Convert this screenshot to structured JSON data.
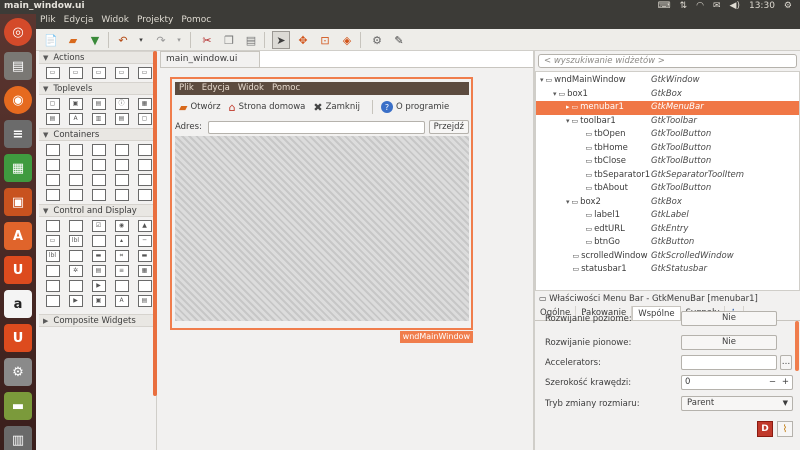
{
  "window_title": "main_window.ui",
  "tray_time": "13:30",
  "app_menu": [
    "Plik",
    "Edycja",
    "Widok",
    "Projekty",
    "Pomoc"
  ],
  "palette": {
    "groups": [
      {
        "name": "Actions",
        "icons": [
          "action-icon",
          "action-icon",
          "action-icon",
          "action-icon",
          "action-icon"
        ]
      },
      {
        "name": "Toplevels",
        "icons": [
          "window-icon",
          "dialog-icon",
          "message-icon",
          "about-icon",
          "color-icon",
          "file-icon",
          "font-icon",
          "assistant-icon",
          "recent-icon",
          "app-icon"
        ]
      },
      {
        "name": "Containers",
        "icons": [
          "box-icon",
          "grid-icon",
          "table-icon",
          "layout-icon",
          "paned-icon",
          "notebook-icon",
          "expander-icon",
          "frame-icon",
          "alignment-icon",
          "viewport-icon",
          "eventbox-icon",
          "scrolled-icon",
          "toolbar-icon",
          "menu-icon",
          "menubar-icon",
          "fixed-icon",
          "overlay-icon",
          "infobar-icon",
          "stack-icon",
          "headerbar-icon"
        ]
      },
      {
        "name": "Control and Display",
        "icons": [
          "button-icon",
          "toggle-icon",
          "check-icon",
          "radio-icon",
          "image-icon",
          "entry-icon",
          "label-icon",
          "combo-icon",
          "spin-icon",
          "scale-icon",
          "label-icon",
          "accel-icon",
          "switch-icon",
          "link-icon",
          "progress-icon",
          "level-icon",
          "spinner-icon",
          "tree-icon",
          "text-icon",
          "calendar-icon",
          "statusbar-icon",
          "separator-icon",
          "arrow-icon",
          "icon-view-icon",
          "draw-icon",
          "scroll-icon",
          "play-icon",
          "color-btn-icon",
          "font-btn-icon",
          "file-btn-icon"
        ]
      },
      {
        "name": "Composite Widgets",
        "icons": []
      }
    ]
  },
  "doc_tab": "main_window.ui",
  "preview": {
    "menu": [
      "Plik",
      "Edycja",
      "Widok",
      "Pomoc"
    ],
    "toolbar": [
      {
        "label": "Otwórz",
        "icon": "folder-open-icon"
      },
      {
        "label": "Strona domowa",
        "icon": "home-icon"
      },
      {
        "label": "Zamknij",
        "icon": "close-icon"
      },
      {
        "label": "O programie",
        "icon": "help-icon"
      }
    ],
    "address_label": "Adres:",
    "go_button": "Przejdź",
    "window_name": "wndMainWindow"
  },
  "search_placeholder": "< wyszukiwanie widżetów >",
  "tree": [
    {
      "name": "wndMainWindow",
      "type": "GtkWindow",
      "level": 0,
      "expander": "▾"
    },
    {
      "name": "box1",
      "type": "GtkBox",
      "level": 1,
      "expander": "▾"
    },
    {
      "name": "menubar1",
      "type": "GtkMenuBar",
      "level": 2,
      "expander": "▸",
      "selected": true
    },
    {
      "name": "toolbar1",
      "type": "GtkToolbar",
      "level": 2,
      "expander": "▾"
    },
    {
      "name": "tbOpen",
      "type": "GtkToolButton",
      "level": 3,
      "expander": ""
    },
    {
      "name": "tbHome",
      "type": "GtkToolButton",
      "level": 3,
      "expander": ""
    },
    {
      "name": "tbClose",
      "type": "GtkToolButton",
      "level": 3,
      "expander": ""
    },
    {
      "name": "tbSeparator1",
      "type": "GtkSeparatorToolItem",
      "level": 3,
      "expander": ""
    },
    {
      "name": "tbAbout",
      "type": "GtkToolButton",
      "level": 3,
      "expander": ""
    },
    {
      "name": "box2",
      "type": "GtkBox",
      "level": 2,
      "expander": "▾"
    },
    {
      "name": "label1",
      "type": "GtkLabel",
      "level": 3,
      "expander": ""
    },
    {
      "name": "edtURL",
      "type": "GtkEntry",
      "level": 3,
      "expander": ""
    },
    {
      "name": "btnGo",
      "type": "GtkButton",
      "level": 3,
      "expander": ""
    },
    {
      "name": "scrolledWindow",
      "type": "GtkScrolledWindow",
      "level": 2,
      "expander": ""
    },
    {
      "name": "statusbar1",
      "type": "GtkStatusbar",
      "level": 2,
      "expander": ""
    }
  ],
  "properties_header": "Właściwości Menu Bar - GtkMenuBar [menubar1]",
  "property_tabs": [
    "Ogólne",
    "Pakowanie",
    "Wspólne",
    "Sygnały"
  ],
  "active_property_tab": "Wspólne",
  "properties": [
    {
      "label": "Rozwijanie poziome:",
      "value": "Nie",
      "kind": "button"
    },
    {
      "label": "Rozwijanie pionowe:",
      "value": "Nie",
      "kind": "button"
    },
    {
      "label": "Accelerators:",
      "value": "",
      "kind": "entry"
    },
    {
      "label": "Szerokość krawędzi:",
      "value": "0",
      "kind": "spin"
    },
    {
      "label": "Tryb zmiany rozmiaru:",
      "value": "Parent",
      "kind": "combo"
    }
  ],
  "accent": "#f07746"
}
